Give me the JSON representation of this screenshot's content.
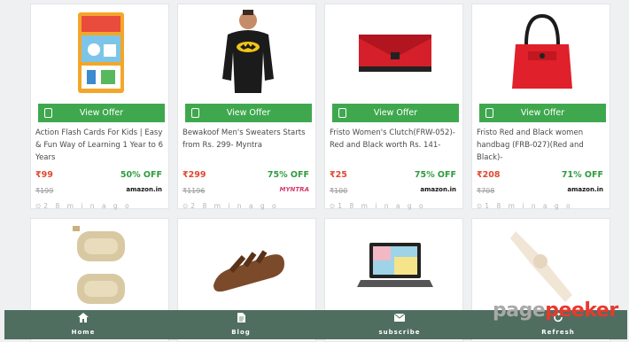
{
  "products": [
    {
      "title": "Action Flash Cards For Kids | Easy & Fun Way of Learning 1 Year to 6 Years",
      "offer_label": "View Offer",
      "price": "₹99",
      "discount": "50% OFF",
      "mrp": "₹199",
      "store": "amazon.in",
      "time": "2 8 m i n a g o",
      "image": "flash-cards-box"
    },
    {
      "title": "Bewakoof Men's Sweaters Starts from Rs. 299- Myntra",
      "offer_label": "View Offer",
      "price": "₹299",
      "discount": "75% OFF",
      "mrp": "₹1196",
      "store": "MYNTRA",
      "time": "2 8 m i n a g o",
      "image": "black-sweater"
    },
    {
      "title": "Fristo Women's Clutch(FRW-052)-Red and Black worth Rs. 141-",
      "offer_label": "View Offer",
      "price": "₹25",
      "discount": "75% OFF",
      "mrp": "₹100",
      "store": "amazon.in",
      "time": "1 8 m i n a g o",
      "image": "red-clutch"
    },
    {
      "title": "Fristo Red and Black women handbag (FRB-027)(Red and Black)-",
      "offer_label": "View Offer",
      "price": "₹208",
      "discount": "71% OFF",
      "mrp": "₹708",
      "store": "amazon.in",
      "time": "1 8 m i n a g o",
      "image": "red-handbag"
    },
    {
      "image": "neck-pillows"
    },
    {
      "image": "brown-sandal"
    },
    {
      "image": "laptop"
    },
    {
      "image": "knee-supports"
    }
  ],
  "bottom_nav": [
    {
      "label": "Home",
      "icon": "home-icon"
    },
    {
      "label": "Blog",
      "icon": "document-icon"
    },
    {
      "label": "subscribe",
      "icon": "envelope-icon"
    },
    {
      "label": "Refresh",
      "icon": "refresh-icon"
    }
  ],
  "watermark": {
    "part1": "page",
    "part2": "peeker"
  },
  "colors": {
    "offer_button": "#3fa84e",
    "price": "#e0482f",
    "discount": "#2e9c3d",
    "nav_bg": "#4f6e60"
  }
}
